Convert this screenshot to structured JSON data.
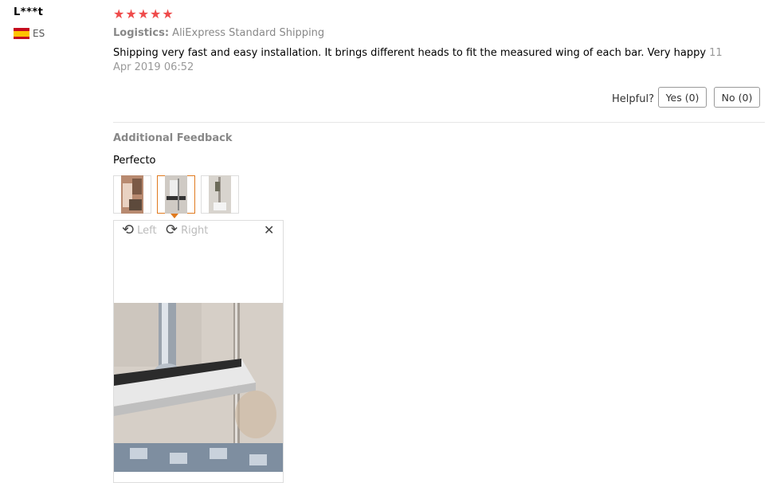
{
  "user": {
    "name": "L***t",
    "country_code": "ES",
    "flag_icon": "spain-flag-icon"
  },
  "rating": {
    "stars": 5,
    "max": 5,
    "glyphs": "★★★★★",
    "color": "#ef4b4b"
  },
  "logistics": {
    "label": "Logistics:",
    "value": "AliExpress Standard Shipping"
  },
  "review": {
    "text": "Shipping very fast and easy installation. It brings different heads to fit the measured wing of each bar. Very happy",
    "day": "11",
    "date": "Apr 2019 06:52"
  },
  "helpful": {
    "label": "Helpful?",
    "yes": "Yes (0)",
    "no": "No (0)"
  },
  "additional": {
    "heading": "Additional Feedback",
    "text": "Perfecto"
  },
  "thumbnails": {
    "selected_index": 1,
    "accent": "#e07a1f"
  },
  "viewer": {
    "left_label": "Left",
    "right_label": "Right",
    "close_glyph": "✕",
    "left_icon": "rotate-left-icon",
    "right_icon": "rotate-right-icon"
  }
}
